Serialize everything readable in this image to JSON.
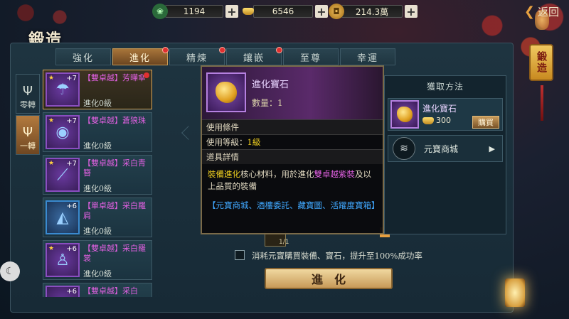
{
  "topbar": {
    "currencies": [
      {
        "icon": "jade-coin-icon",
        "value": "1194"
      },
      {
        "icon": "gold-ingot-icon",
        "value": "6546"
      },
      {
        "icon": "copper-coin-icon",
        "value": "214.3萬"
      }
    ],
    "plus_label": "+",
    "back_label": "返回"
  },
  "title": "鍛造",
  "tabs": [
    {
      "label": "強化",
      "dot": false
    },
    {
      "label": "進化",
      "dot": true
    },
    {
      "label": "精煉",
      "dot": true
    },
    {
      "label": "鑲嵌",
      "dot": true
    },
    {
      "label": "至尊",
      "dot": false
    },
    {
      "label": "幸運",
      "dot": false
    }
  ],
  "side_tabs": [
    {
      "label": "零轉"
    },
    {
      "label": "一轉"
    }
  ],
  "items": [
    {
      "name": "【雙卓越】芳曄傘",
      "level": "+7",
      "status": "進化0級"
    },
    {
      "name": "【雙卓越】蒼狼珠",
      "level": "+7",
      "status": "進化0級"
    },
    {
      "name": "【雙卓越】采白青簪",
      "level": "+7",
      "status": "進化0級"
    },
    {
      "name": "【單卓越】采白羅肩",
      "level": "+6",
      "status": "進化0級"
    },
    {
      "name": "【雙卓越】采白羅裳",
      "level": "+6",
      "status": "進化0級"
    },
    {
      "name": "【雙卓越】采白",
      "level": "+6",
      "status": ""
    }
  ],
  "tooltip": {
    "name": "進化寶石",
    "count_label": "數量：1",
    "use_cond_header": "使用條件",
    "use_level_label": "使用等級：",
    "use_level_value": "1級",
    "detail_header": "道具詳情",
    "desc_part1": "裝備進化",
    "desc_part2": "核心材料，用於進化",
    "desc_part3": "雙卓越紫裝",
    "desc_part4": "及以上品質的裝備",
    "sources": "【元寶商城、酒樓委託、藏寶圖、活躍度寶箱】"
  },
  "acquire": {
    "title": "獲取方法",
    "item_name": "進化寶石",
    "price": "300",
    "buy_label": "購買",
    "shop_name": "元寶商城",
    "shop_arrow": "▶"
  },
  "bottom": {
    "slot_count": "1/1",
    "consume_text": "消耗元寶購買裝備、寶石，提升至100%成功率",
    "evolve_label": "進化"
  },
  "seal_text": "鍛造"
}
